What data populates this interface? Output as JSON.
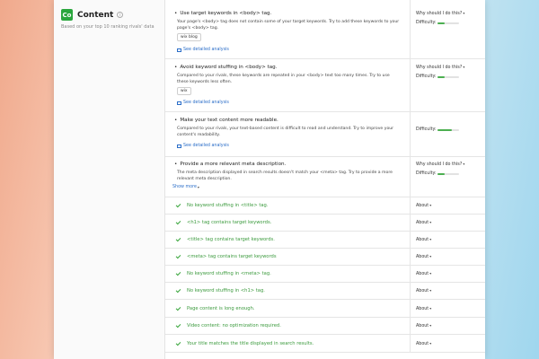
{
  "section": {
    "logo_text": "Co",
    "title": "Content",
    "info_glyph": "i",
    "subtitle": "Based on your top 10 ranking rivals' data"
  },
  "ideas": [
    {
      "title": "Use target keywords in <body> tag.",
      "desc": "Your page's <body> tag does not contain some of your target keywords. Try to add these keywords to your page's <body> tag.",
      "chip": "wix blog",
      "link": "See detailed analysis",
      "why": "Why should I do this?",
      "difficulty_label": "Difficulty:",
      "difficulty": 1
    },
    {
      "title": "Avoid keyword stuffing in <body> tag.",
      "desc": "Compared to your rivals, these keywords are repeated in your <body> text too many times. Try to use these keywords less often.",
      "chip": "wix",
      "link": "See detailed analysis",
      "why": "Why should I do this?",
      "difficulty_label": "Difficulty:",
      "difficulty": 1
    },
    {
      "title": "Make your text content more readable.",
      "desc": "Compared to your rivals, your text-based content is difficult to read and understand. Try to improve your content's readability.",
      "link": "See detailed analysis",
      "difficulty_label": "Difficulty:",
      "difficulty": 2
    },
    {
      "title": "Provide a more relevant meta description.",
      "desc": "The meta description displayed in search results doesn't match your <meta> tag. Try to provide a more relevant meta description.",
      "link": "Show more",
      "why": "Why should I do this?",
      "difficulty_label": "Difficulty:",
      "difficulty": 1
    }
  ],
  "checks": [
    {
      "text": "No keyword stuffing in <title> tag.",
      "about": "About"
    },
    {
      "text": "<h1> tag contains target keywords.",
      "about": "About"
    },
    {
      "text": "<title> tag contains target keywords.",
      "about": "About"
    },
    {
      "text": "<meta> tag contains target keywords",
      "about": "About"
    },
    {
      "text": "No keyword stuffing in <meta> tag.",
      "about": "About"
    },
    {
      "text": "No keyword stuffing in <h1> tag.",
      "about": "About"
    },
    {
      "text": "Page content is long enough.",
      "about": "About"
    },
    {
      "text": "Video content: no optimization required.",
      "about": "About"
    },
    {
      "text": "Your title matches the title displayed in search results.",
      "about": "About"
    }
  ],
  "colors": {
    "accent_green": "#2aa63d",
    "check_text_green": "#3b9a3d",
    "link_blue": "#2b6ec8"
  }
}
